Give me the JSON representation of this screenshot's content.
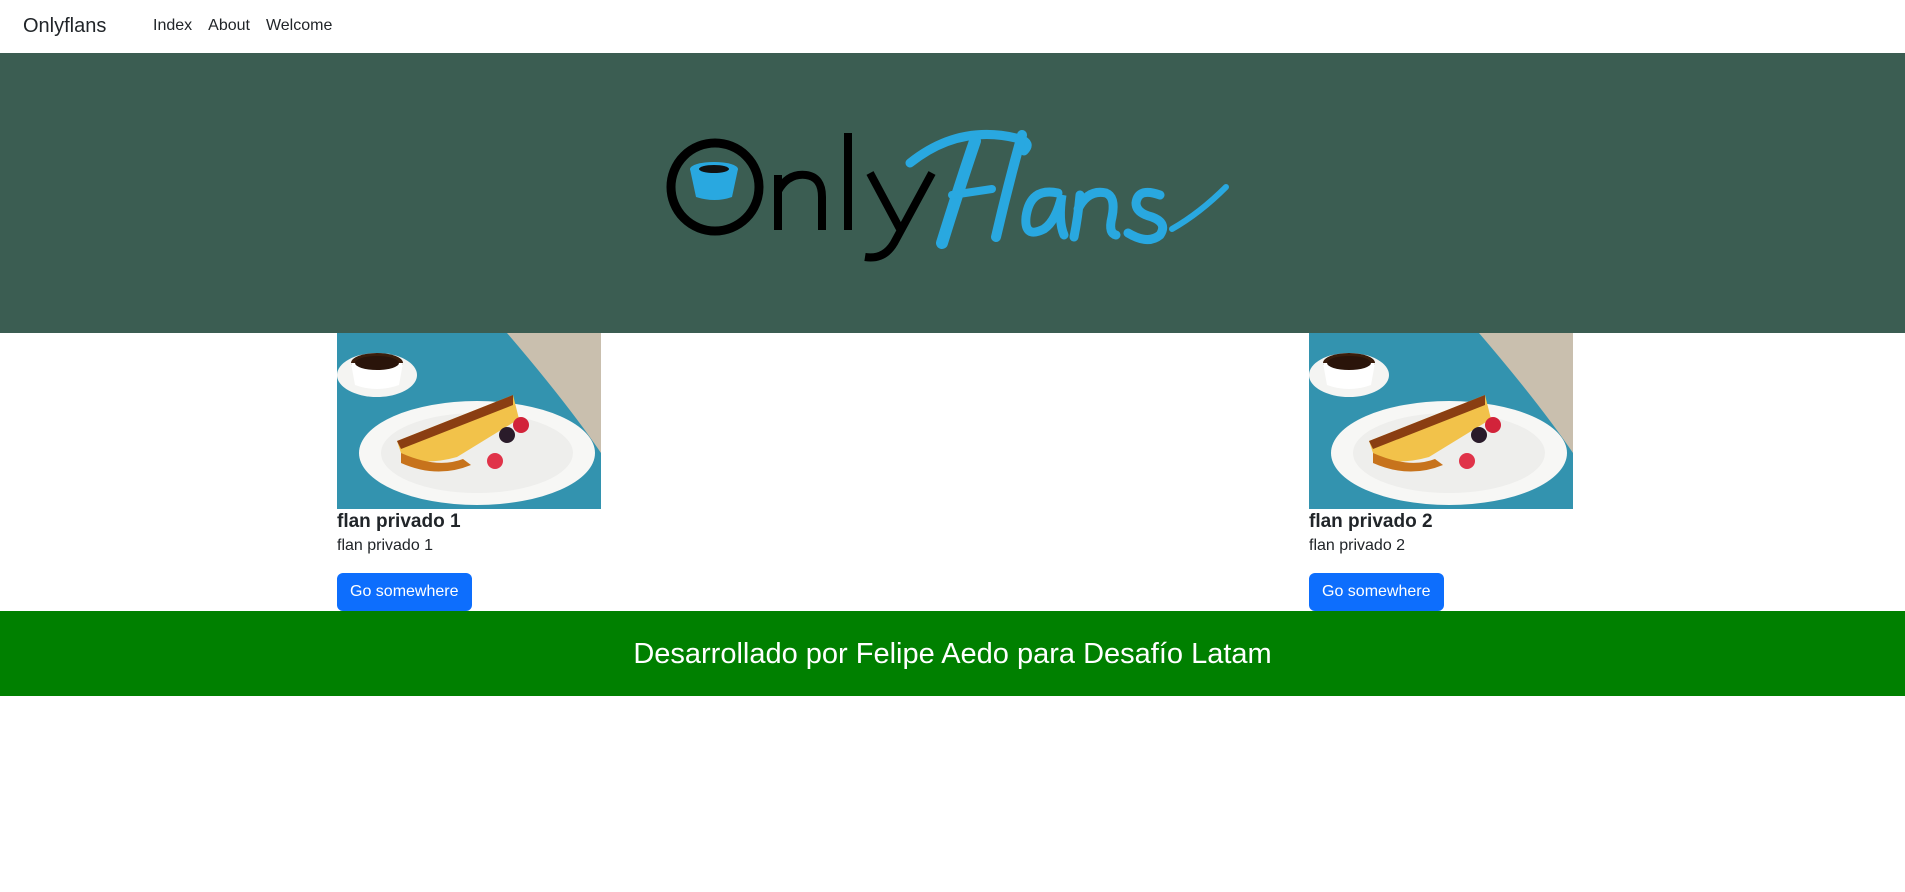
{
  "navbar": {
    "brand": "Onlyflans",
    "links": [
      "Index",
      "About",
      "Welcome"
    ]
  },
  "hero": {
    "logo_text_left": "Only",
    "logo_text_right": "Flans",
    "background": "#3b5d52",
    "accent": "#29a8e0"
  },
  "cards": [
    {
      "title": "flan privado 1",
      "text": "flan privado 1",
      "button": "Go somewhere"
    },
    {
      "title": "flan privado 2",
      "text": "flan privado 2",
      "button": "Go somewhere"
    }
  ],
  "footer": {
    "text": "Desarrollado por Felipe Aedo para Desafío Latam",
    "background": "#008000"
  },
  "colors": {
    "primary_button": "#0d6efd"
  }
}
